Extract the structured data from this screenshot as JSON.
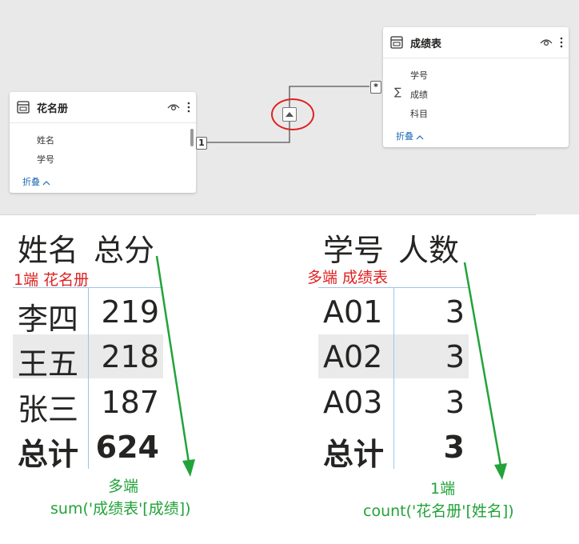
{
  "model_view": {
    "roster_table": {
      "title": "花名册",
      "fields": [
        "姓名",
        "学号"
      ],
      "collapse_label": "折叠",
      "cardinality_label": "1"
    },
    "scores_table": {
      "title": "成绩表",
      "fields": [
        "学号",
        "成绩",
        "科目"
      ],
      "sum_field_symbol": "∑",
      "collapse_label": "折叠",
      "cardinality_label": "*"
    }
  },
  "left_matrix": {
    "headers": [
      "姓名",
      "总分"
    ],
    "note": "1端 花名册",
    "rows": [
      {
        "name": "李四",
        "value": "219"
      },
      {
        "name": "王五",
        "value": "218"
      },
      {
        "name": "张三",
        "value": "187"
      }
    ],
    "total": {
      "label": "总计",
      "value": "624"
    },
    "annotation_line1": "多端",
    "annotation_line2": "sum('成绩表'[成绩])"
  },
  "right_matrix": {
    "headers": [
      "学号",
      "人数"
    ],
    "note": "多端 成绩表",
    "rows": [
      {
        "name": "A01",
        "value": "3"
      },
      {
        "name": "A02",
        "value": "3"
      },
      {
        "name": "A03",
        "value": "3"
      }
    ],
    "total": {
      "label": "总计",
      "value": "3"
    },
    "annotation_line1": "1端",
    "annotation_line2": "count('花名册'[姓名])"
  },
  "colors": {
    "highlight_red": "#e02020",
    "annotation_green": "#22a339",
    "link_blue": "#1f6bb5",
    "row_shade": "#eaeaea"
  }
}
